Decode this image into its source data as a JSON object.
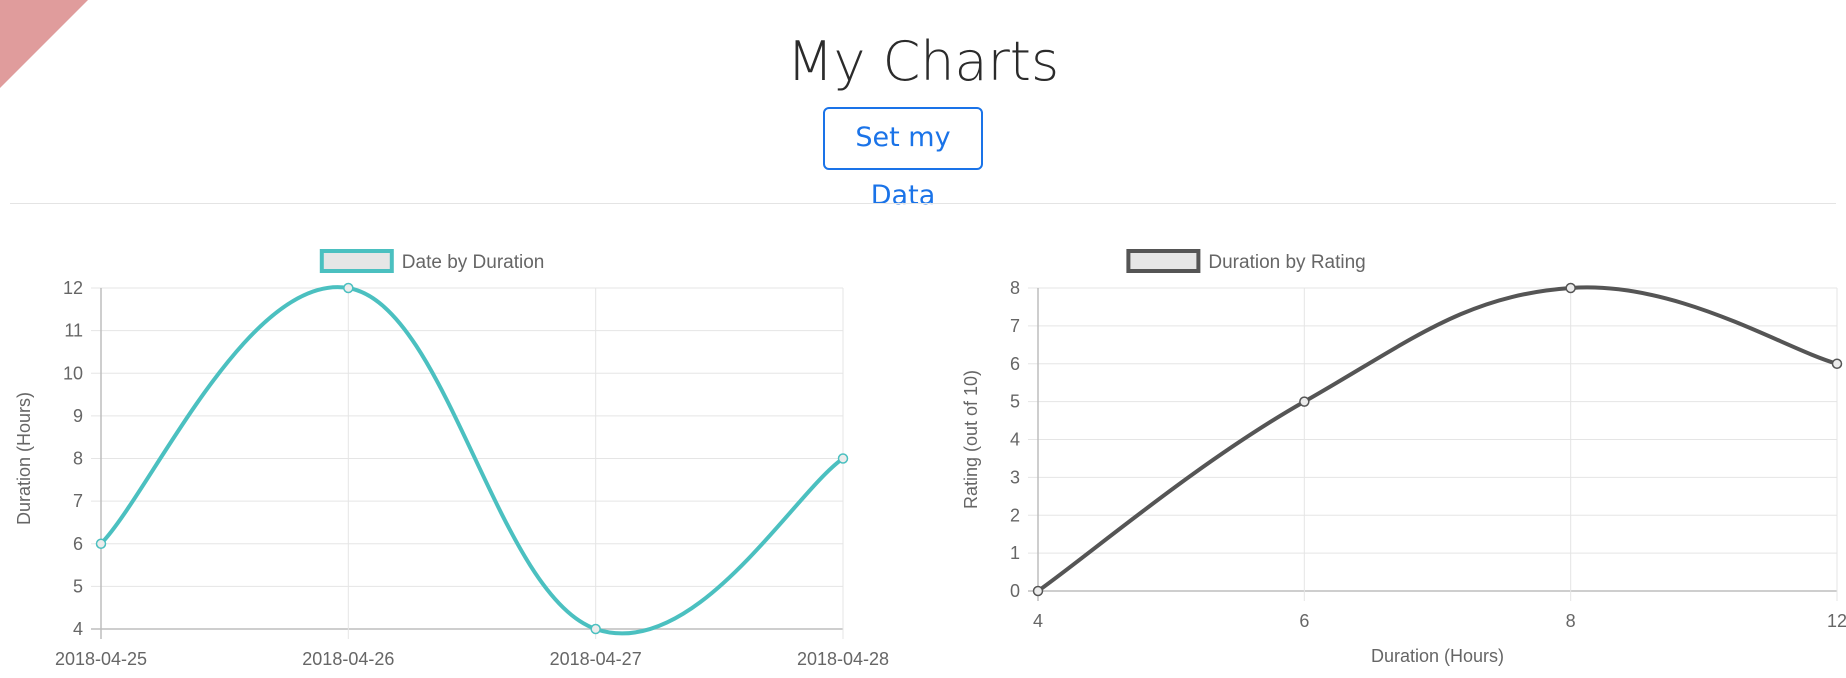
{
  "header": {
    "title": "My Charts",
    "button_label": "Set my Data"
  },
  "colors": {
    "accent": "#1a73e8",
    "corner_ribbon": "#e09c9c",
    "series1": "#4bc0c0",
    "series2": "#555555"
  },
  "chart_data": [
    {
      "type": "line",
      "legend": "Date by Duration",
      "legend_position": "top",
      "x_type": "category",
      "x": [
        "2018-04-25",
        "2018-04-26",
        "2018-04-27",
        "2018-04-28"
      ],
      "y": [
        6,
        12,
        4,
        8
      ],
      "ylabel": "Duration (Hours)",
      "xlabel": "",
      "ylim": [
        4,
        12
      ],
      "yticks": [
        4,
        5,
        6,
        7,
        8,
        9,
        10,
        11,
        12
      ],
      "grid": true,
      "color": "#4bc0c0"
    },
    {
      "type": "line",
      "legend": "Duration by Rating",
      "legend_position": "top",
      "x_type": "category",
      "x": [
        "4",
        "6",
        "8",
        "12"
      ],
      "y": [
        0,
        5,
        8,
        6
      ],
      "ylabel": "Rating (out of 10)",
      "xlabel": "Duration (Hours)",
      "ylim": [
        0,
        8
      ],
      "yticks": [
        0,
        1,
        2,
        3,
        4,
        5,
        6,
        7,
        8
      ],
      "grid": true,
      "color": "#555555"
    }
  ]
}
